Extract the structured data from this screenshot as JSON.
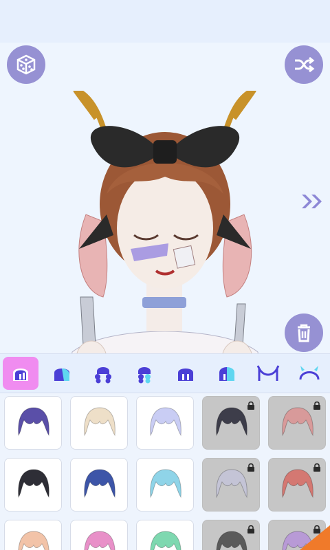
{
  "toolbar": {
    "left_button_icon": "dice-cube-icon",
    "right_button_icon": "shuffle-icon",
    "next_icon": "double-chevron-right-icon",
    "delete_icon": "trash-icon"
  },
  "colors": {
    "accent": "#9691d3",
    "tab_active": "#f08cf0",
    "tab_icon": "#4b3fd6",
    "tab_icon_light": "#5fd6f0"
  },
  "tabs": [
    {
      "icon": "hair-full-icon",
      "active": true
    },
    {
      "icon": "hair-front-icon",
      "active": false
    },
    {
      "icon": "hair-curly-icon",
      "active": false
    },
    {
      "icon": "hair-side-icon",
      "active": false
    },
    {
      "icon": "hair-bob-icon",
      "active": false
    },
    {
      "icon": "hair-split-icon",
      "active": false
    },
    {
      "icon": "horns-icon",
      "active": false
    },
    {
      "icon": "headband-icon",
      "active": false
    }
  ],
  "items": [
    {
      "color": "#5a4fa8",
      "locked": false
    },
    {
      "color": "#eedfc8",
      "locked": false
    },
    {
      "color": "#c9cdf4",
      "locked": false
    },
    {
      "color": "#3d3d4a",
      "locked": true
    },
    {
      "color": "#d89a9a",
      "locked": true
    },
    {
      "color": "#2e2e36",
      "locked": false
    },
    {
      "color": "#3d55a8",
      "locked": false
    },
    {
      "color": "#8fd4e8",
      "locked": false
    },
    {
      "color": "#c4c4d6",
      "locked": true
    },
    {
      "color": "#d47872",
      "locked": true
    },
    {
      "color": "#f2c3a8",
      "locked": false
    },
    {
      "color": "#e890c8",
      "locked": false
    },
    {
      "color": "#7ed8b0",
      "locked": false
    },
    {
      "color": "#5a5a5a",
      "locked": true
    },
    {
      "color": "#b89ad6",
      "locked": true
    }
  ]
}
